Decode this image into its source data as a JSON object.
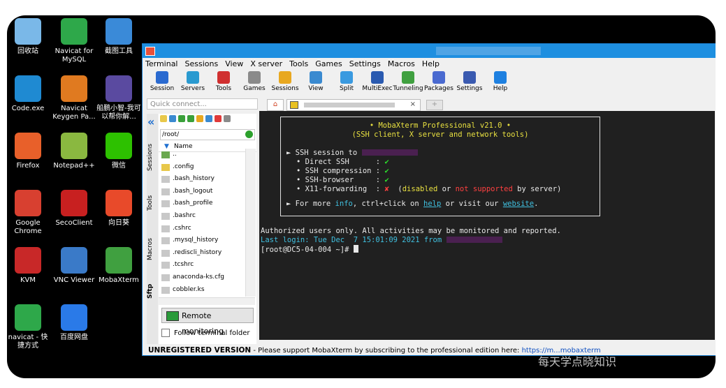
{
  "desktop": {
    "icons": [
      {
        "label": "回收站",
        "icon": "recycle-bin-icon",
        "color": "#7ab8e8"
      },
      {
        "label": "Navicat for MySQL",
        "icon": "navicat-icon",
        "color": "#2ea84a"
      },
      {
        "label": "截图工具",
        "icon": "snipping-tool-icon",
        "color": "#3a8ad8"
      },
      {
        "label": "Code.exe",
        "icon": "vscode-icon",
        "color": "#1f8ad2"
      },
      {
        "label": "Navicat Keygen Pa...",
        "icon": "navicat-keygen-icon",
        "color": "#e07a20"
      },
      {
        "label": "船鹏小智-我可以帮你解...",
        "icon": "chuanpeng-icon",
        "color": "#5a4aa0"
      },
      {
        "label": "Firefox",
        "icon": "firefox-icon",
        "color": "#e8602a"
      },
      {
        "label": "Notepad++",
        "icon": "notepadpp-icon",
        "color": "#8ab840"
      },
      {
        "label": "微信",
        "icon": "wechat-icon",
        "color": "#2dc100"
      },
      {
        "label": "Google Chrome",
        "icon": "chrome-icon",
        "color": "#d84030"
      },
      {
        "label": "SecoClient",
        "icon": "secoclient-icon",
        "color": "#c82020"
      },
      {
        "label": "向日葵",
        "icon": "sunlogin-icon",
        "color": "#e84a2a"
      },
      {
        "label": "KVM",
        "icon": "kvm-icon",
        "color": "#c82828"
      },
      {
        "label": "VNC Viewer",
        "icon": "vnc-viewer-icon",
        "color": "#3a7ac8"
      },
      {
        "label": "MobaXterm",
        "icon": "mobaxterm-icon",
        "color": "#40a040"
      },
      {
        "label": "navicat - 快捷方式",
        "icon": "navicat-shortcut-icon",
        "color": "#2ea84a"
      },
      {
        "label": "百度网盘",
        "icon": "baidu-netdisk-icon",
        "color": "#2a7ae8"
      }
    ]
  },
  "window": {
    "menu": [
      "Terminal",
      "Sessions",
      "View",
      "X server",
      "Tools",
      "Games",
      "Settings",
      "Macros",
      "Help"
    ],
    "toolbar": [
      {
        "label": "Session",
        "icon": "session-icon",
        "color": "#2a6ad0"
      },
      {
        "label": "Servers",
        "icon": "servers-icon",
        "color": "#2a9ad0"
      },
      {
        "label": "Tools",
        "icon": "tools-icon",
        "color": "#d03030"
      },
      {
        "label": "Games",
        "icon": "games-icon",
        "color": "#8a8a8a"
      },
      {
        "label": "Sessions",
        "icon": "star-icon",
        "color": "#e8a820"
      },
      {
        "label": "View",
        "icon": "view-icon",
        "color": "#3a8ad0"
      },
      {
        "label": "Split",
        "icon": "split-icon",
        "color": "#3a9ae0"
      },
      {
        "label": "MultiExec",
        "icon": "multiexec-icon",
        "color": "#2a5ab0"
      },
      {
        "label": "Tunneling",
        "icon": "tunneling-icon",
        "color": "#40a040"
      },
      {
        "label": "Packages",
        "icon": "packages-icon",
        "color": "#4a6ad0"
      },
      {
        "label": "Settings",
        "icon": "settings-icon",
        "color": "#3a5ab0"
      },
      {
        "label": "Help",
        "icon": "help-icon",
        "color": "#1e80e0"
      }
    ],
    "quick_connect_placeholder": "Quick connect...",
    "tab_close": "×",
    "side_tabs": [
      "Sessions",
      "Tools",
      "Macros",
      "Sftp"
    ],
    "sftp": {
      "path": "/root/",
      "column_header": "Name",
      "files": [
        {
          "name": "..",
          "kind": "up"
        },
        {
          "name": ".config",
          "kind": "folder"
        },
        {
          "name": ".bash_history",
          "kind": "file"
        },
        {
          "name": ".bash_logout",
          "kind": "file"
        },
        {
          "name": ".bash_profile",
          "kind": "file"
        },
        {
          "name": ".bashrc",
          "kind": "file"
        },
        {
          "name": ".cshrc",
          "kind": "file"
        },
        {
          "name": ".mysql_history",
          "kind": "file"
        },
        {
          "name": ".rediscli_history",
          "kind": "file"
        },
        {
          "name": ".tcshrc",
          "kind": "file"
        },
        {
          "name": "anaconda-ks.cfg",
          "kind": "file"
        },
        {
          "name": "cobbler.ks",
          "kind": "file"
        }
      ],
      "remote_monitoring": "Remote monitoring",
      "follow_terminal": "Follow terminal folder"
    },
    "terminal": {
      "banner_title": "• MobaXterm Professional v21.0 •",
      "banner_subtitle": "(SSH client, X server and network tools)",
      "ssh_session_to": "SSH session to",
      "rows": [
        {
          "label": "• Direct SSH      :",
          "mark": "✔",
          "ok": true
        },
        {
          "label": "• SSH compression :",
          "mark": "✔",
          "ok": true
        },
        {
          "label": "• SSH-browser     :",
          "mark": "✔",
          "ok": true
        },
        {
          "label": "• X11-forwarding  :",
          "mark": "✘",
          "ok": false
        }
      ],
      "x11_note_open": "(",
      "x11_disabled": "disabled",
      "x11_or": "or",
      "x11_not_supported": "not supported",
      "x11_by_server": "by server)",
      "more_info_prefix": "► For more",
      "more_info_info": "info",
      "more_info_mid": ", ctrl+click on",
      "more_info_help": "help",
      "more_info_visit": "or visit our",
      "more_info_website": "website",
      "more_info_end": ".",
      "warning": "Authorized users only. All activities may be monitored and reported.",
      "last_login": "Last login: Tue Dec  7 15:01:09 2021 from",
      "prompt": "[root@DC5-04-004 ~]#"
    },
    "status_bar": {
      "unregistered": "UNREGISTERED VERSION",
      "message": " -  Please support MobaXterm by subscribing to the professional edition here:",
      "url": "https://m...mobaxterm"
    }
  },
  "watermark": "每天学点晓知识"
}
